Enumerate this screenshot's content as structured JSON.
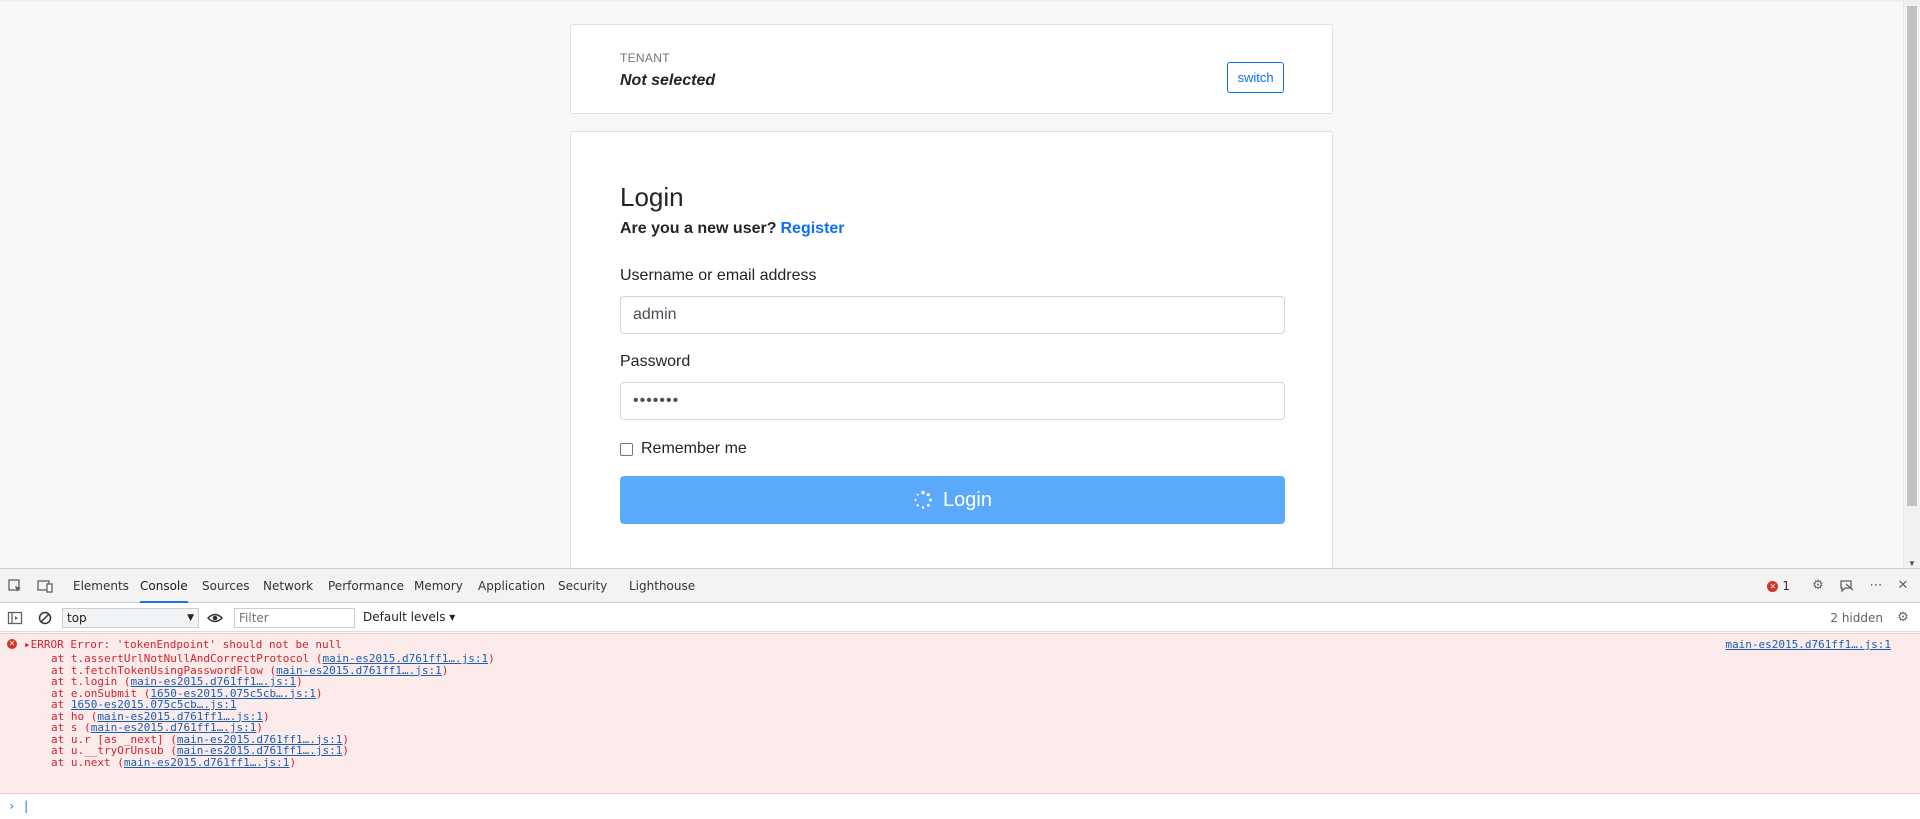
{
  "tenant": {
    "label": "TENANT",
    "value": "Not selected",
    "switch_label": "switch"
  },
  "login": {
    "title": "Login",
    "new_user_text": "Are you a new user?",
    "register_link": "Register",
    "username_label": "Username or email address",
    "username_value": "admin",
    "password_label": "Password",
    "password_value": "•••••••",
    "remember_label": "Remember me",
    "submit_label": "Login"
  },
  "devtools": {
    "tabs": [
      "Elements",
      "Console",
      "Sources",
      "Network",
      "Performance",
      "Memory",
      "Application",
      "Security",
      "Lighthouse"
    ],
    "active_tab": "Console",
    "error_count": "1",
    "context": "top",
    "filter_placeholder": "Filter",
    "levels": "Default levels ▾",
    "hidden": "2 hidden",
    "error": {
      "head": "ERROR Error: 'tokenEndpoint' should not be null",
      "source": "main-es2015.d761ff1….js:1",
      "trace": [
        {
          "pre": "at t.assertUrlNotNullAndCorrectProtocol (",
          "link": "main-es2015.d761ff1….js:1",
          "post": ")"
        },
        {
          "pre": "at t.fetchTokenUsingPasswordFlow (",
          "link": "main-es2015.d761ff1….js:1",
          "post": ")"
        },
        {
          "pre": "at t.login (",
          "link": "main-es2015.d761ff1….js:1",
          "post": ")"
        },
        {
          "pre": "at e.onSubmit (",
          "link": "1650-es2015.075c5cb….js:1",
          "post": ")"
        },
        {
          "pre": "at ",
          "link": "1650-es2015.075c5cb….js:1",
          "post": ""
        },
        {
          "pre": "at ho (",
          "link": "main-es2015.d761ff1….js:1",
          "post": ")"
        },
        {
          "pre": "at s (",
          "link": "main-es2015.d761ff1….js:1",
          "post": ")"
        },
        {
          "pre": "at u.r [as _next] (",
          "link": "main-es2015.d761ff1….js:1",
          "post": ")"
        },
        {
          "pre": "at u.__tryOrUnsub (",
          "link": "main-es2015.d761ff1….js:1",
          "post": ")"
        },
        {
          "pre": "at u.next (",
          "link": "main-es2015.d761ff1….js:1",
          "post": ")"
        }
      ]
    }
  },
  "colors": {
    "primary": "#0d6efd",
    "button_loading": "#5aa9fa",
    "error_text": "#d1242f",
    "error_bg": "#fcebeb"
  }
}
